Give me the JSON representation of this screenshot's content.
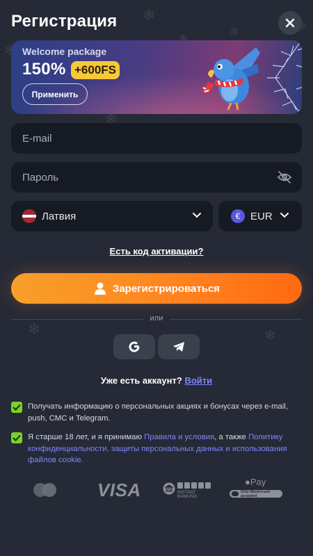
{
  "header": {
    "title": "Регистрация"
  },
  "banner": {
    "subtitle": "Welcome package",
    "percent": "150%",
    "badge": "+600FS",
    "apply_label": "Применить"
  },
  "form": {
    "email_placeholder": "E-mail",
    "password_placeholder": "Пароль",
    "country": "Латвия",
    "currency": "EUR",
    "currency_symbol": "€"
  },
  "activation_link": "Есть код активации?",
  "register_label": "Зарегистрироваться",
  "or_label": "или",
  "login": {
    "prompt": "Уже есть аккаунт?",
    "link": "Войти"
  },
  "consents": {
    "marketing": "Получать информацию о персональных акциях и бонусах через e-mail, push, СМС и Telegram.",
    "terms_prefix": "Я старше 18 лет, и я принимаю",
    "terms_link": "Правила и условия",
    "terms_middle": ", а также",
    "privacy_link": "Политику конфиденциальности, защиты персональных данных и использования файлов cookie."
  },
  "payments": {
    "visa": "VISA",
    "instant_banking": "INSTANT BANKING",
    "apple_pay": "Pay",
    "apple_note": "Only Mastercard accepted"
  },
  "colors": {
    "background": "#262a36",
    "field": "#161a22",
    "accent_orange": "#ff8420",
    "link": "#7c86ff",
    "checkbox": "#7ad12a",
    "badge": "#f7c83a"
  }
}
